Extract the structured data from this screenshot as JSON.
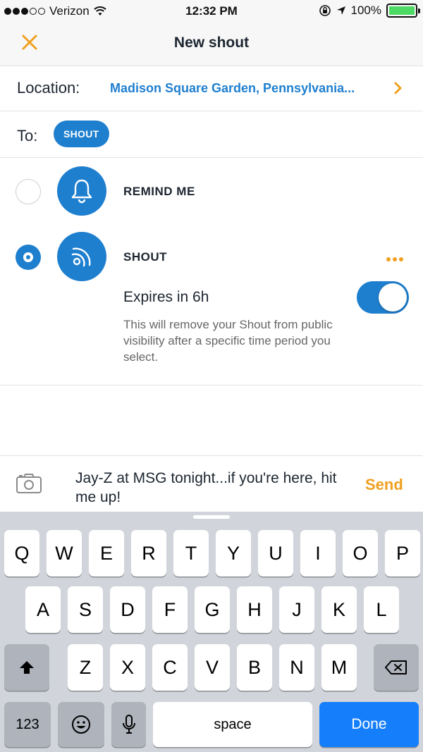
{
  "status_bar": {
    "carrier": "Verizon",
    "time": "12:32 PM",
    "battery_percent": "100%"
  },
  "nav": {
    "title": "New shout"
  },
  "location": {
    "label": "Location:",
    "value": "Madison Square Garden, Pennsylvania..."
  },
  "to": {
    "label": "To:",
    "pill": "SHOUT"
  },
  "options": [
    {
      "label": "REMIND ME",
      "selected": false,
      "icon": "bell-icon"
    },
    {
      "label": "SHOUT",
      "selected": true,
      "icon": "broadcast-icon"
    }
  ],
  "expires": {
    "label": "Expires in 6h",
    "enabled": true,
    "description": "This will remove your Shout from public visibility after a specific time period you select."
  },
  "compose": {
    "message": "Jay-Z at MSG tonight...if you're here, hit me up!",
    "send_label": "Send"
  },
  "keyboard": {
    "row1": [
      "Q",
      "W",
      "E",
      "R",
      "T",
      "Y",
      "U",
      "I",
      "O",
      "P"
    ],
    "row2": [
      "A",
      "S",
      "D",
      "F",
      "G",
      "H",
      "J",
      "K",
      "L"
    ],
    "row3": [
      "Z",
      "X",
      "C",
      "V",
      "B",
      "N",
      "M"
    ],
    "numbers_label": "123",
    "space_label": "space",
    "done_label": "Done"
  },
  "colors": {
    "accent_blue": "#1f7fcf",
    "accent_orange": "#f0a020",
    "keyboard_done": "#147efb"
  }
}
